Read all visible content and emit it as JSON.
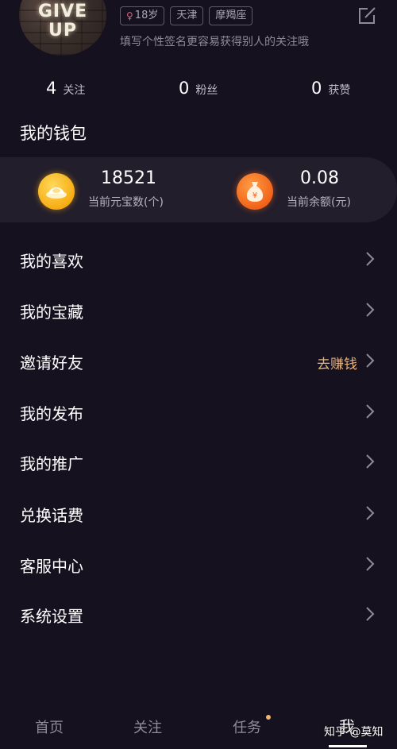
{
  "profile": {
    "avatar_text_line1": "GIVE",
    "avatar_text_line2": "UP",
    "tags": [
      {
        "label": "18岁",
        "icon": "female-icon"
      },
      {
        "label": "天津"
      },
      {
        "label": "摩羯座"
      }
    ],
    "signature": "填写个性签名更容易获得别人的关注哦"
  },
  "stats": [
    {
      "value": "4",
      "label": "关注"
    },
    {
      "value": "0",
      "label": "粉丝"
    },
    {
      "value": "0",
      "label": "获赞"
    }
  ],
  "wallet": {
    "title": "我的钱包",
    "ingots": {
      "value": "18521",
      "label": "当前元宝数(个)"
    },
    "balance": {
      "value": "0.08",
      "label": "当前余额(元)"
    }
  },
  "menu": [
    {
      "label": "我的喜欢"
    },
    {
      "label": "我的宝藏"
    },
    {
      "label": "邀请好友",
      "extra": "去赚钱"
    },
    {
      "label": "我的发布"
    },
    {
      "label": "我的推广"
    },
    {
      "label": "兑换话费"
    },
    {
      "label": "客服中心"
    },
    {
      "label": "系统设置"
    }
  ],
  "tabs": [
    {
      "label": "首页"
    },
    {
      "label": "关注"
    },
    {
      "label": "任务",
      "badge": true
    },
    {
      "label": "我",
      "active": true
    }
  ],
  "watermark": "知乎 @莫知",
  "colors": {
    "background": "#15111f",
    "card": "#221e2c",
    "accent_text": "#e9b27a",
    "gold_coin": "#f6a90f",
    "orange_coin": "#ef5f16"
  }
}
